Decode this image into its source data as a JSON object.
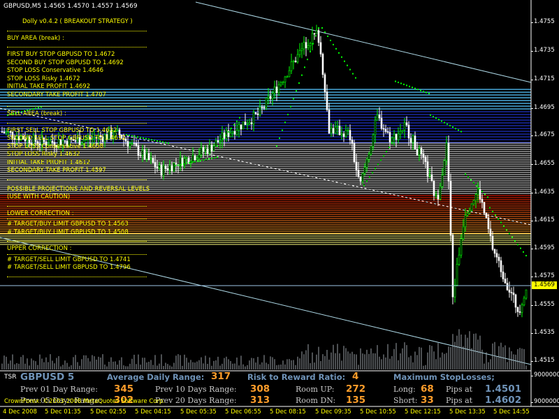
{
  "chart": {
    "header": "GBPUSD,M5  1.4565 1.4570 1.4557 1.4569",
    "current_price": "1.4569",
    "price_ticks": [
      "1.4755",
      "1.4735",
      "1.4715",
      "1.4695",
      "1.4675",
      "1.4655",
      "1.4635",
      "1.4615",
      "1.4595",
      "1.4575",
      "1.4555",
      "1.4535",
      "1.4515"
    ],
    "indicator_ticks": [
      "9000000",
      "9000000"
    ],
    "time_ticks": [
      "4 Dec 2008",
      "5 Dec 01:35",
      "5 Dec 02:55",
      "5 Dec 04:15",
      "5 Dec 05:35",
      "5 Dec 06:55",
      "5 Dec 08:15",
      "5 Dec 09:35",
      "5 Dec 10:55",
      "5 Dec 12:15",
      "5 Dec 13:35",
      "5 Dec 14:55"
    ],
    "colors": {
      "background": "#000000",
      "bull": "#00ff00",
      "bear": "#ffffff",
      "text": "#ffff00",
      "dots": "#00ff00",
      "lines": "#add8e6",
      "buy_zone": "#1f2fc0",
      "sell_zone": "#ffffff",
      "projection": "#ff2000",
      "correction": "#ffff80"
    }
  },
  "strategy": {
    "title": "Dolly v0.4.2 ( BREAKOUT STRATEGY )",
    "buy_header": "BUY AREA (break) :",
    "buy_lines": [
      "FIRST BUY STOP  GBPUSD TO 1.4672",
      "SECOND BUY STOP  GBPUSD TO 1.4692",
      "STOP LOSS Conservative 1.4646",
      "STOP LOSS Risky 1.4672",
      "INITIAL TAKE PROFIT 1.4692",
      "SECONDARY TAKE PROFIT 1.4707"
    ],
    "sell_header": "SELL AREA (break) :",
    "sell_lines": [
      "FIRST SELL STOP  GBPUSD TO 1.4632",
      "SECOND SELL STOP  GBPUSD TO 1.4612",
      "STOP LOSS Conservative 1.4658",
      "STOP LOSS Risky 1.4632",
      "INITIAL TAKE PROFIT 1.4612",
      "SECONDARY TAKE PROFIT 1.4597"
    ],
    "projection_lines": [
      "POSSIBLE PROJECTIONS AND REVERSAL LEVELS",
      "(USE WITH CAUTION)"
    ],
    "lower_header": "LOWER CORRECTION :",
    "lower_lines": [
      "# TARGET/BUY LIMIT  GBPUSD TO 1.4563",
      "# TARGET/BUY LIMIT  GBPUSD TO 1.4508"
    ],
    "upper_header": "UPPER CORRECTION :",
    "upper_lines": [
      "# TARGET/SELL LIMIT  GBPUSD TO 1.4741",
      "# TARGET/SELL LIMIT  GBPUSD TO 1.4796"
    ]
  },
  "tsr": {
    "tag": "TSR",
    "symbol": "GBPUSD 5",
    "adr_label": "Average Daily Range:",
    "adr_value": "317",
    "rr_label": "Risk to Reward Ratio:",
    "rr_value": "4",
    "max_sl_label": "Maximum StopLosses;",
    "prev01_label": "Prev 01 Day Range:",
    "prev01_value": "345",
    "prev05_label": "Prev 05 Days Range:",
    "prev05_value": "302",
    "prev10_label": "Prev 10 Days Range:",
    "prev10_value": "308",
    "prev20_label": "Prev 20 Days Range:",
    "prev20_value": "313",
    "room_up_label": "Room UP:",
    "room_up_value": "272",
    "room_dn_label": "Room DN:",
    "room_dn_value": "135",
    "long_label": "Long:",
    "long_value": "68",
    "short_label": "Short:",
    "short_value": "33",
    "pips_at_label_1": "Pips at",
    "pips_at_value_1": "1.4501",
    "pips_at_label_2": "Pips at",
    "pips_at_value_2": "1.4602",
    "copyright": "CrownForex: ©2003-2008 MetaQuotes Software Corp."
  }
}
